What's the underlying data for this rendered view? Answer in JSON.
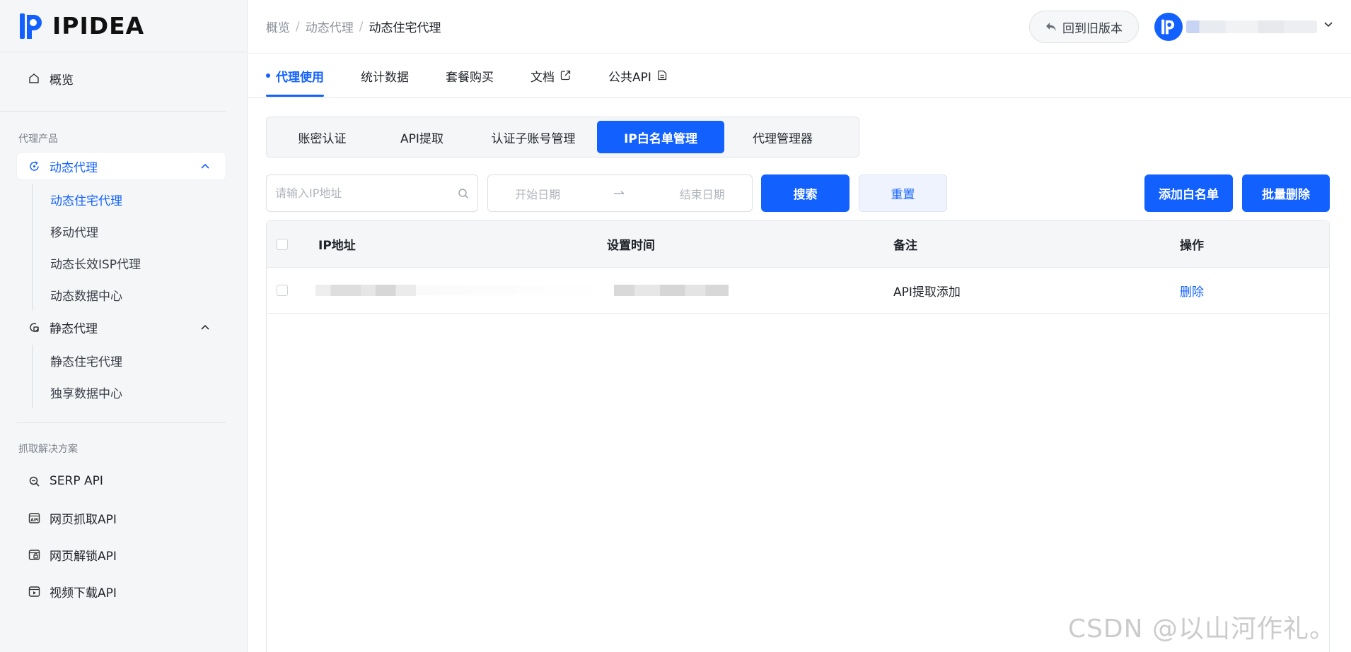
{
  "brand": {
    "name": "IPIDEA",
    "accent": "#1261ff"
  },
  "sidebar": {
    "overview": "概览",
    "section_proxy": "代理产品",
    "dynamic_proxy": {
      "label": "动态代理",
      "items": [
        "动态住宅代理",
        "移动代理",
        "动态长效ISP代理",
        "动态数据中心"
      ]
    },
    "static_proxy": {
      "label": "静态代理",
      "items": [
        "静态住宅代理",
        "独享数据中心"
      ]
    },
    "section_scrape": "抓取解决方案",
    "scrape_items": [
      "SERP API",
      "网页抓取API",
      "网页解锁API",
      "视频下载API"
    ]
  },
  "header": {
    "breadcrumb": [
      "概览",
      "动态代理",
      "动态住宅代理"
    ],
    "back_label": "回到旧版本"
  },
  "tabs": [
    "代理使用",
    "统计数据",
    "套餐购买",
    "文档",
    "公共API"
  ],
  "subtabs": [
    "账密认证",
    "API提取",
    "认证子账号管理",
    "IP白名单管理",
    "代理管理器"
  ],
  "filter": {
    "ip_placeholder": "请输入IP地址",
    "start_date": "开始日期",
    "end_date": "结束日期",
    "search": "搜索",
    "reset": "重置",
    "add": "添加白名单",
    "batch_delete": "批量删除"
  },
  "table": {
    "columns": [
      "IP地址",
      "设置时间",
      "备注",
      "操作"
    ],
    "rows": [
      {
        "note": "API提取添加",
        "action": "删除"
      }
    ]
  },
  "watermark": "CSDN @以山河作礼。"
}
